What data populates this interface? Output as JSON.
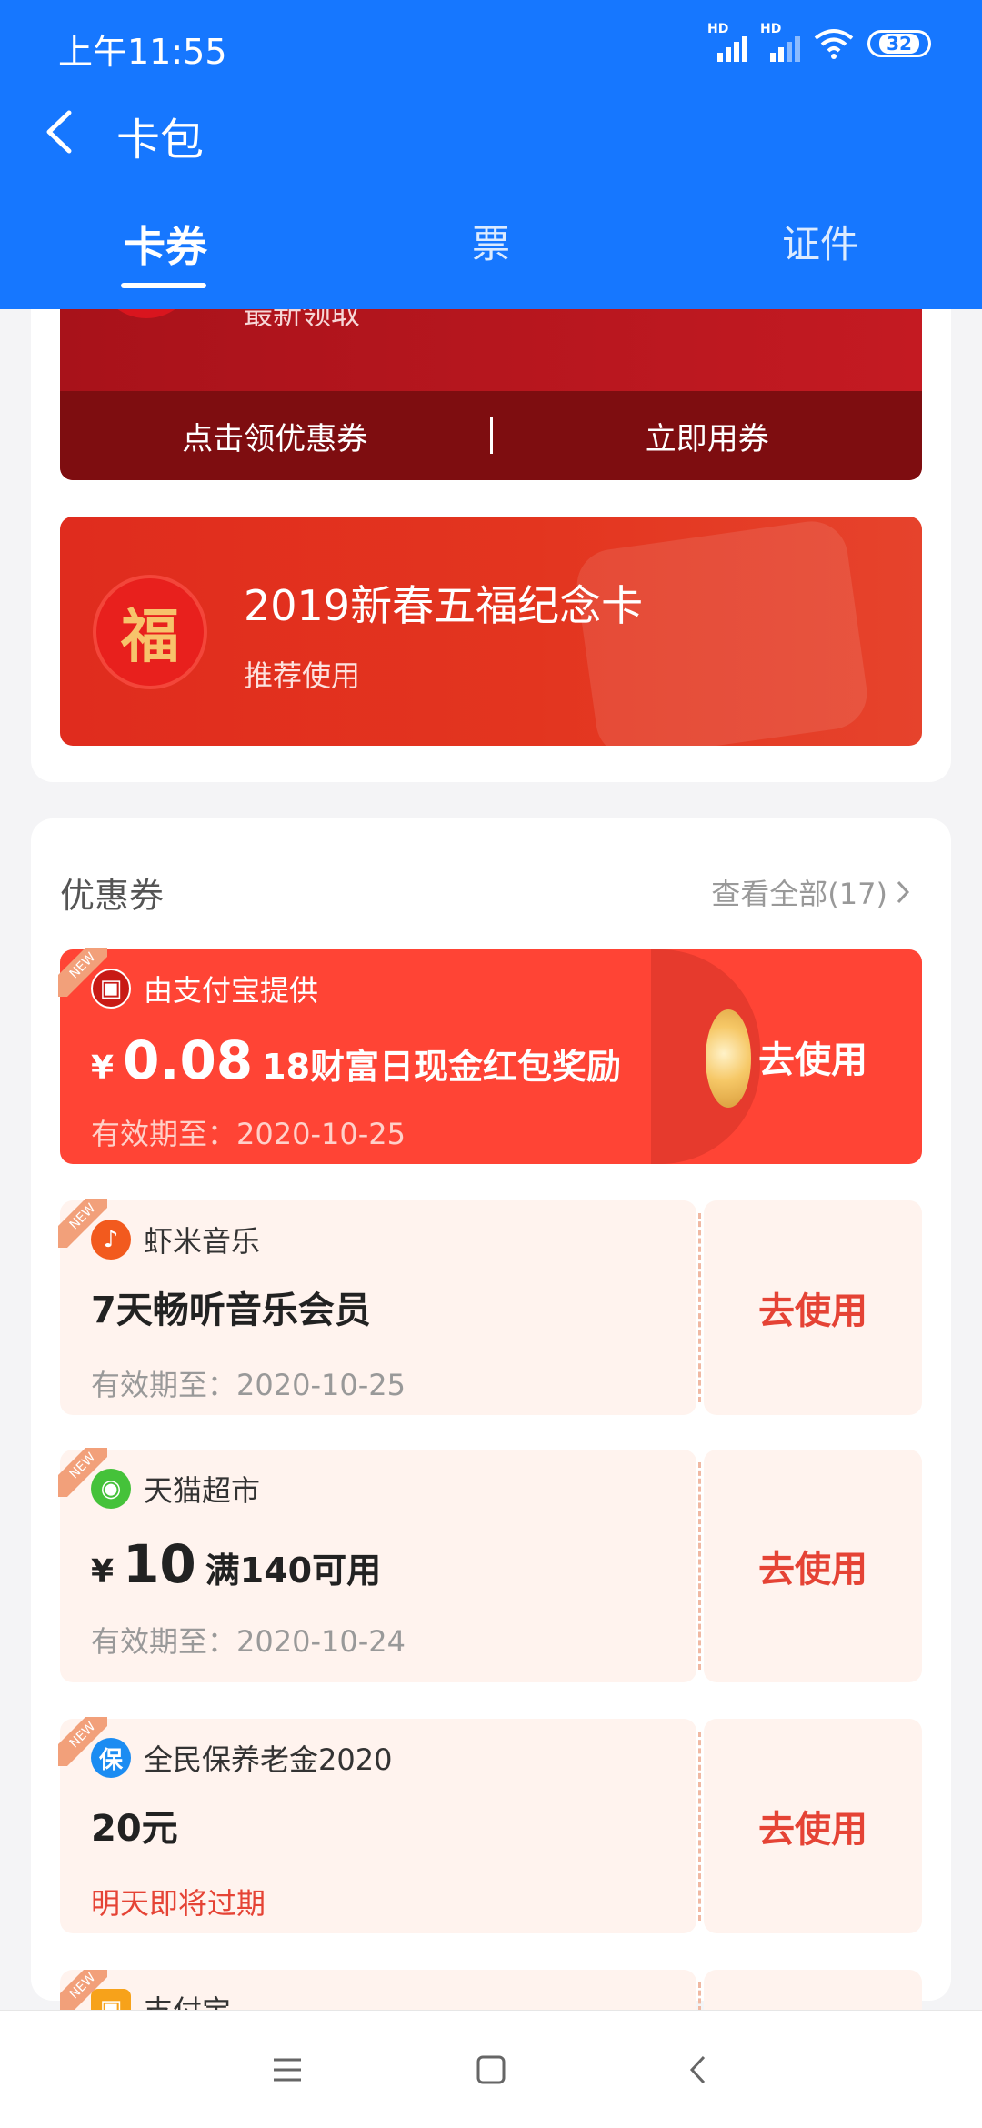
{
  "status_bar": {
    "time": "上午11:55",
    "battery": "32",
    "signal_label": "HD"
  },
  "nav": {
    "title": "卡包"
  },
  "tabs": [
    {
      "label": "卡券",
      "active": true
    },
    {
      "label": "票",
      "active": false
    },
    {
      "label": "证件",
      "active": false
    }
  ],
  "red_card": {
    "subtitle": "最新领取",
    "action_left": "点击领优惠券",
    "action_right": "立即用券"
  },
  "fu_card": {
    "logo_char": "福",
    "title": "2019新春五福纪念卡",
    "subtitle": "推荐使用"
  },
  "coupons_section": {
    "title": "优惠券",
    "view_all": "查看全部(17)"
  },
  "coupons": [
    {
      "brand": "由支付宝提供",
      "currency": "¥",
      "amount": "0.08",
      "description": "18财富日现金红包奖励",
      "expiry": "有效期至：2020-10-25",
      "action": "去使用",
      "tag": "NEW"
    },
    {
      "brand": "虾米音乐",
      "description": "7天畅听音乐会员",
      "expiry": "有效期至：2020-10-25",
      "action": "去使用",
      "tag": "NEW"
    },
    {
      "brand": "天猫超市",
      "currency": "¥",
      "amount": "10",
      "description": "满140可用",
      "expiry": "有效期至：2020-10-24",
      "action": "去使用",
      "tag": "NEW"
    },
    {
      "brand": "全民保养老金2020",
      "brand_icon_char": "保",
      "description": "20元",
      "expiry": "明天即将过期",
      "action": "去使用",
      "tag": "NEW"
    },
    {
      "brand": "支付宝",
      "tag": "NEW"
    }
  ],
  "colors": {
    "header_blue": "#1677ff",
    "coupon_red": "#ff4435",
    "action_red": "#e54335"
  }
}
